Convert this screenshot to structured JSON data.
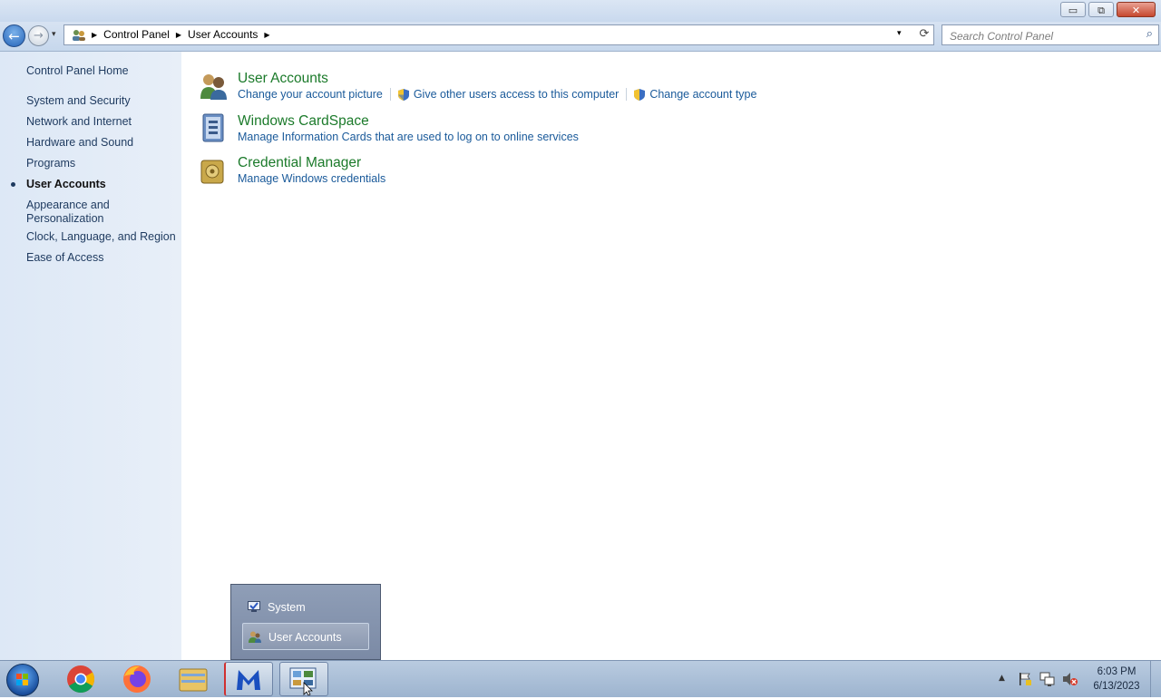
{
  "window": {
    "minimize_glyph": "▭",
    "restore_glyph": "⧉",
    "close_glyph": "✕"
  },
  "navbar": {
    "back_glyph": "←",
    "forward_glyph": "→",
    "recent_glyph": "▾",
    "breadcrumbs": [
      "Control Panel",
      "User Accounts"
    ],
    "crumb_sep": "▶",
    "dropdown_glyph": "▾",
    "refresh_glyph": "⟳"
  },
  "search": {
    "placeholder": "Search Control Panel",
    "icon_glyph": "⌕"
  },
  "sidebar": {
    "home": "Control Panel Home",
    "items": [
      {
        "label": "System and Security"
      },
      {
        "label": "Network and Internet"
      },
      {
        "label": "Hardware and Sound"
      },
      {
        "label": "Programs"
      },
      {
        "label": "User Accounts",
        "active": true
      },
      {
        "label": "Appearance and Personalization"
      },
      {
        "label": "Clock, Language, and Region"
      },
      {
        "label": "Ease of Access"
      }
    ]
  },
  "categories": [
    {
      "title": "User Accounts",
      "links": [
        {
          "label": "Change your account picture",
          "shield": false
        },
        {
          "label": "Give other users access to this computer",
          "shield": true
        },
        {
          "label": "Change account type",
          "shield": true
        }
      ]
    },
    {
      "title": "Windows CardSpace",
      "links": [
        {
          "label": "Manage Information Cards that are used to log on to online services",
          "shield": false
        }
      ]
    },
    {
      "title": "Credential Manager",
      "links": [
        {
          "label": "Manage Windows credentials",
          "shield": false
        }
      ]
    }
  ],
  "jumplist": {
    "items": [
      {
        "label": "System",
        "selected": false
      },
      {
        "label": "User Accounts",
        "selected": true
      }
    ]
  },
  "taskbar": {
    "apps": [
      {
        "name": "chrome"
      },
      {
        "name": "firefox"
      },
      {
        "name": "file-explorer"
      },
      {
        "name": "malwarebytes"
      },
      {
        "name": "control-panel"
      }
    ],
    "tray_arrow": "▲",
    "time": "6:03 PM",
    "date": "6/13/2023"
  },
  "colors": {
    "category_title": "#1b7a2a",
    "link": "#1a5a9a",
    "sidebar_bg": "#dde8f6"
  }
}
